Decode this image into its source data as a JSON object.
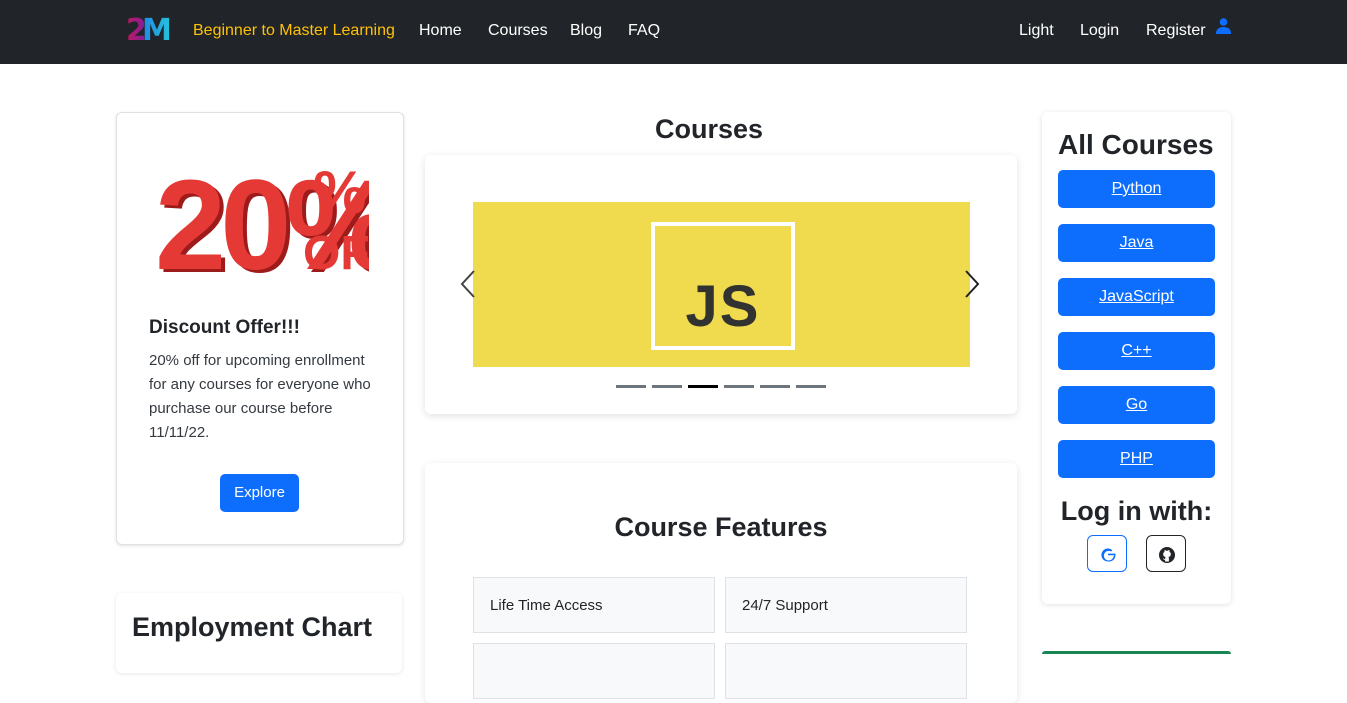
{
  "navbar": {
    "logo_text": "2M",
    "brand": "Beginner to Master Learning",
    "links": [
      "Home",
      "Courses",
      "Blog",
      "FAQ"
    ],
    "right_links": [
      "Light",
      "Login",
      "Register"
    ],
    "icon": "user-icon"
  },
  "offer": {
    "graphic_text": "20%",
    "graphic_subtext": "OFF",
    "title": "Discount Offer!!!",
    "text": "20% off for upcoming enrollment for any courses for everyone who purchase our course before 11/11/22.",
    "button": "Explore"
  },
  "employment": {
    "title": "Employment Chart"
  },
  "courses": {
    "heading": "Courses",
    "slide_text": "JS",
    "indicator_count": 6,
    "active_indicator": 2
  },
  "features": {
    "heading": "Course Features",
    "items": [
      "Life Time Access",
      "24/7 Support"
    ]
  },
  "sidebar": {
    "title": "All Courses",
    "courses": [
      "Python",
      "Java",
      "JavaScript",
      "C++",
      "Go",
      "PHP"
    ],
    "login_title": "Log in with:",
    "social": [
      "google-icon",
      "github-icon"
    ]
  },
  "colors": {
    "navbar_bg": "#212529",
    "brand": "#ffc107",
    "primary": "#0d6efd",
    "js_yellow": "#f0db4f"
  }
}
